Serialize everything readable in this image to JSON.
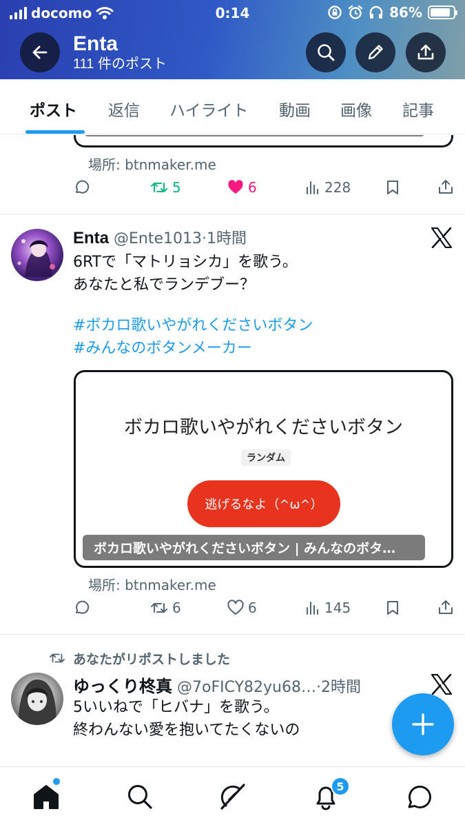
{
  "status_bar": {
    "carrier": "docomo",
    "time": "0:14",
    "battery": "86%",
    "battery_level": 0.86
  },
  "header": {
    "name": "Enta",
    "post_count": "111 件のポスト"
  },
  "tabs": [
    {
      "label": "ポスト",
      "active": true
    },
    {
      "label": "返信"
    },
    {
      "label": "ハイライト"
    },
    {
      "label": "動画"
    },
    {
      "label": "画像"
    },
    {
      "label": "記事"
    }
  ],
  "feed": {
    "post0": {
      "place": "場所: btnmaker.me",
      "retweets": "5",
      "likes": "6",
      "views": "228"
    },
    "post1": {
      "name": "Enta",
      "handle": "@Ente1013",
      "dot": "·",
      "time": "1時間",
      "lines": [
        "6RTで「マトリョシカ」を歌う。",
        "あなたと私でランデブー？"
      ],
      "hashtags": [
        "#ボカロ歌いやがれくださいボタン",
        "#みんなのボタンメーカー"
      ],
      "card": {
        "title": "ボカロ歌いやがれくださいボタン",
        "tag": "ランダム",
        "button": "逃げるなよ（^ω^）",
        "caption": "ボカロ歌いやがれくださいボタン | みんなのボタ…"
      },
      "place": "場所: btnmaker.me",
      "replies": "",
      "retweets": "6",
      "likes": "6",
      "views": "145"
    },
    "post2": {
      "repost_label": "あなたがリポストしました",
      "name": "ゆっくり柊真",
      "handle": "@7oFICY82yu68…",
      "dot": "·",
      "time": "2時間",
      "lines": [
        "5いいねで「ヒバナ」を歌う。",
        "終わんない愛を抱いてたくないの"
      ]
    }
  },
  "notifications_badge": "5",
  "colors": {
    "accent": "#1d9bf0",
    "like": "#f91880",
    "retweet_active": "#00ba7c",
    "card_button": "#e8341f"
  },
  "icons": [
    "back-arrow-icon",
    "search-icon",
    "pen-icon",
    "share-icon",
    "x-logo-icon",
    "reply-icon",
    "retweet-icon",
    "heart-icon",
    "views-icon",
    "bookmark-icon",
    "plus-icon",
    "home-icon",
    "grok-icon",
    "bell-icon",
    "chat-icon"
  ]
}
